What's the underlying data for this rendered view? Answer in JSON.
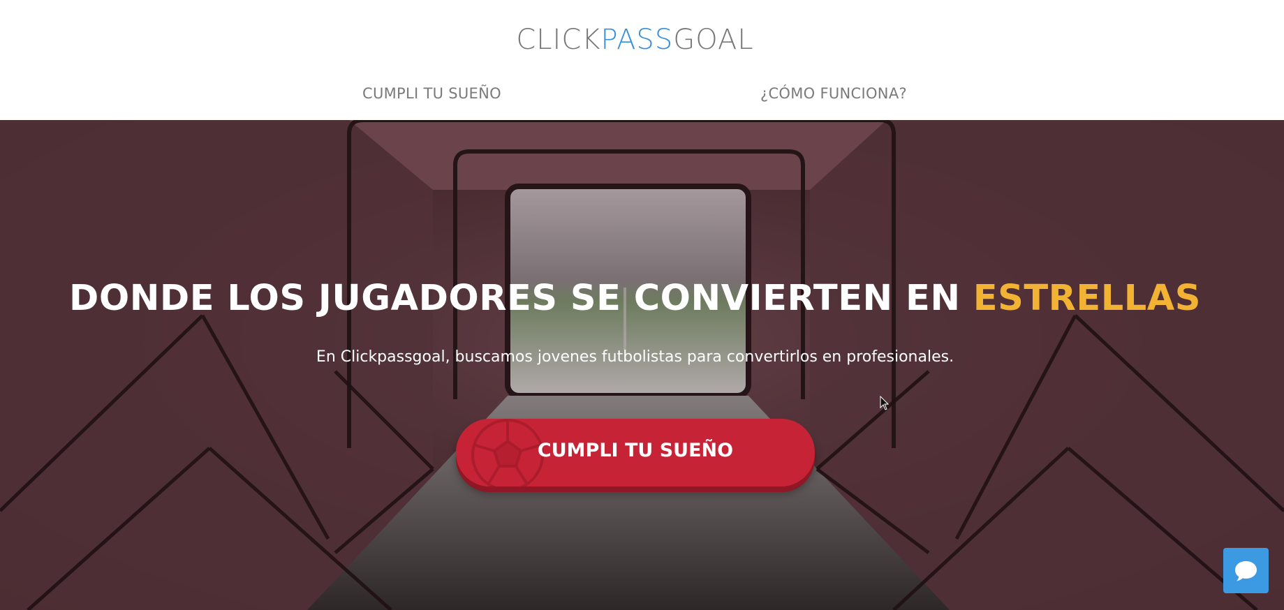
{
  "header": {
    "logo": {
      "part1": "CLICK",
      "part2": "PASS",
      "part3": "GOAL"
    },
    "nav": [
      {
        "label": "CUMPLI TU SUEÑO"
      },
      {
        "label": "¿CÓMO FUNCIONA?"
      }
    ]
  },
  "hero": {
    "title_main": "DONDE LOS JUGADORES SE CONVIERTEN EN ",
    "title_highlight": "ESTRELLAS",
    "subtitle": "En Clickpassgoal, buscamos jovenes futbolistas para convertirlos en profesionales.",
    "cta_label": "CUMPLI TU SUEÑO",
    "cta_icon": "soccer-ball-icon"
  },
  "chat": {
    "icon": "chat-bubble-icon"
  },
  "colors": {
    "accent_blue": "#3a8fd9",
    "highlight_gold": "#f2b233",
    "cta_red": "#c62436",
    "chat_blue": "#3b9ae1"
  }
}
